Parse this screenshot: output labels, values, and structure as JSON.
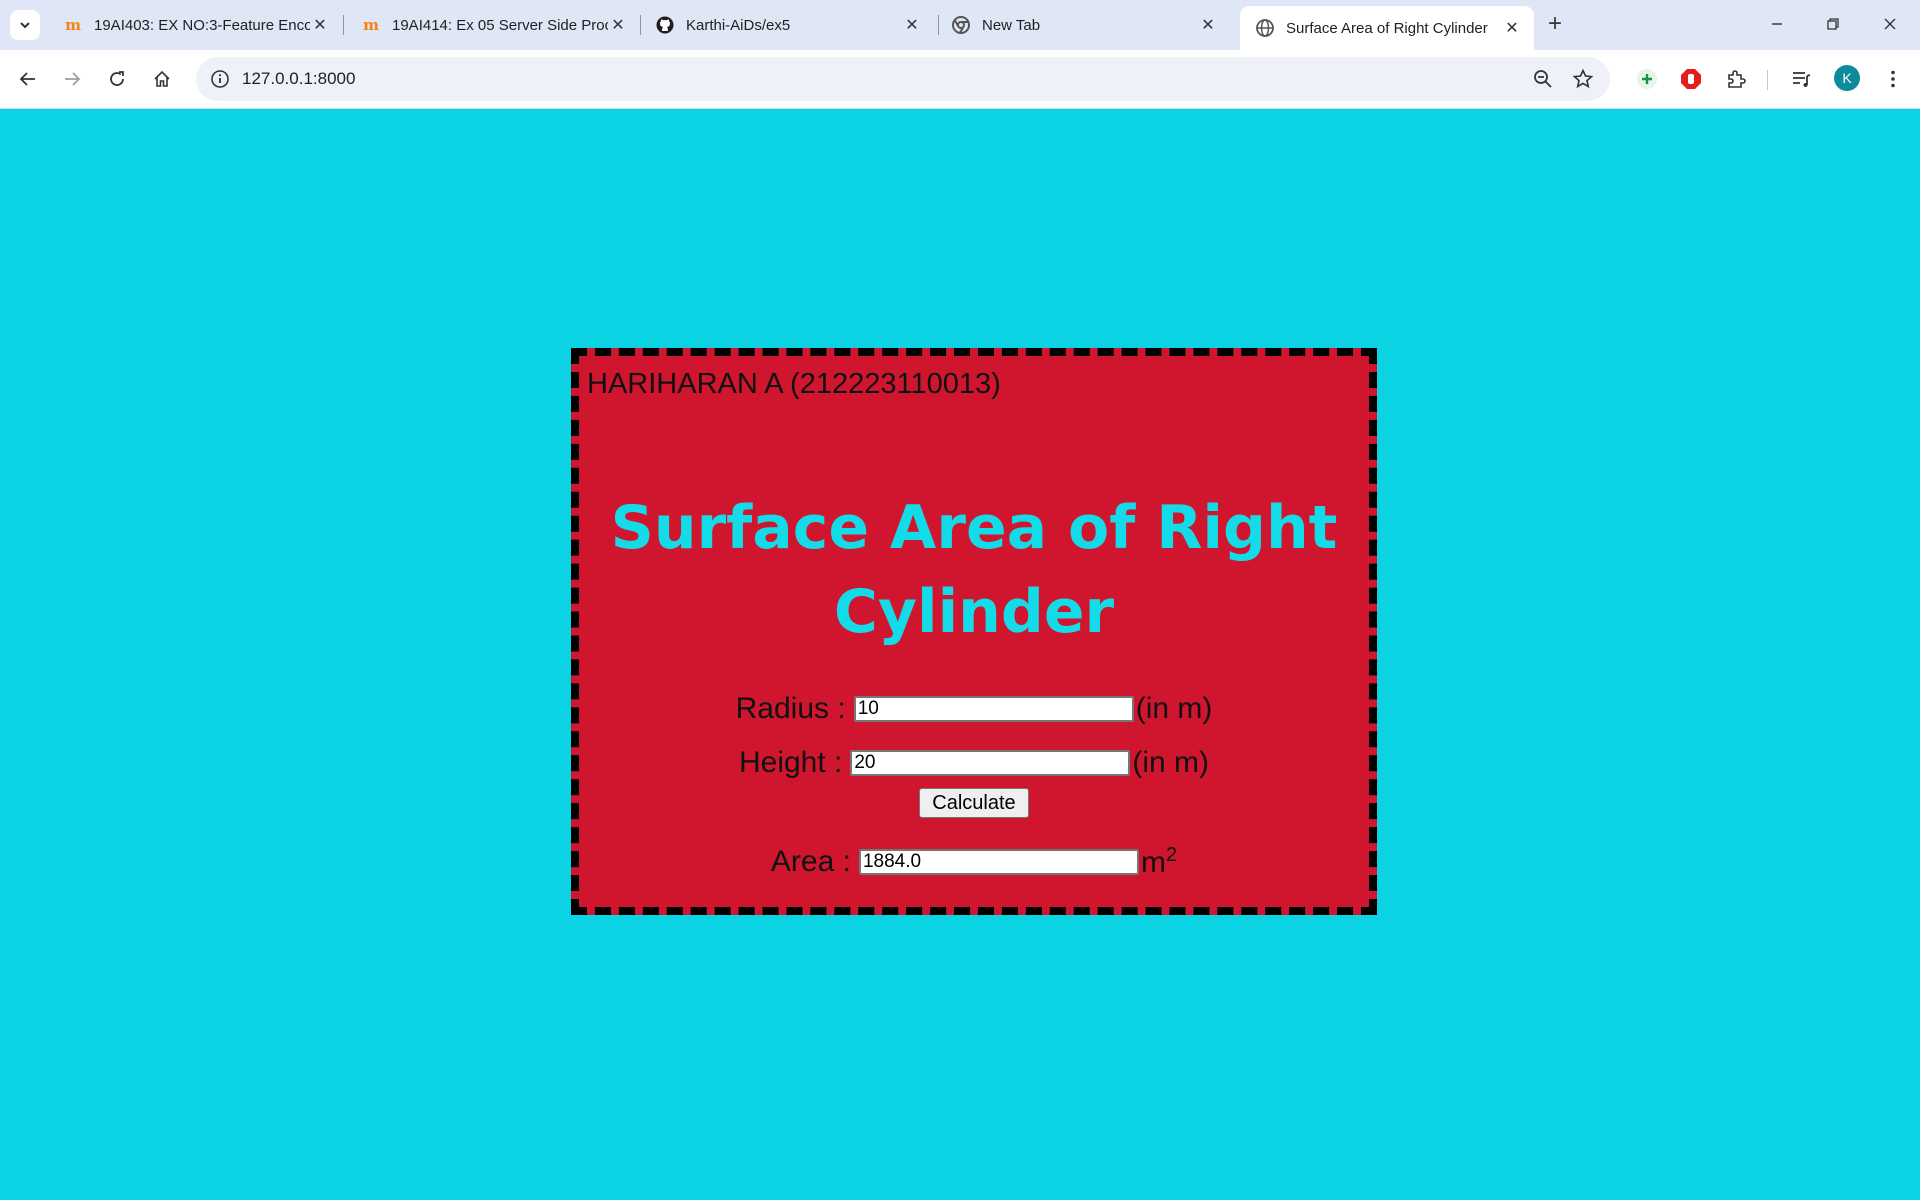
{
  "browser": {
    "tabs": [
      {
        "title": "19AI403: EX NO:3-Feature Enco",
        "icon": "moodle-icon"
      },
      {
        "title": "19AI414: Ex 05 Server Side Proc",
        "icon": "moodle-icon"
      },
      {
        "title": "Karthi-AiDs/ex5",
        "icon": "github-icon"
      },
      {
        "title": "New Tab",
        "icon": "chrome-icon"
      },
      {
        "title": "Surface Area of Right Cylinder",
        "icon": "globe-icon",
        "active": true
      }
    ],
    "url": "127.0.0.1:8000",
    "profile_initial": "K"
  },
  "page": {
    "author": "HARIHARAN A (212223110013)",
    "heading": "Surface Area of Right Cylinder",
    "radius_label": "Radius :",
    "radius_value": "10",
    "radius_unit": "(in m)",
    "height_label": "Height :",
    "height_value": "20",
    "height_unit": "(in m)",
    "calculate_label": "Calculate",
    "area_label": "Area :",
    "area_value": "1884.0",
    "area_unit": "m",
    "area_unit_exponent": "2"
  },
  "colors": {
    "page_background": "#0cd3e3",
    "card_background": "#cf162e",
    "heading_color": "#13dbe8",
    "card_border": "#000000"
  }
}
